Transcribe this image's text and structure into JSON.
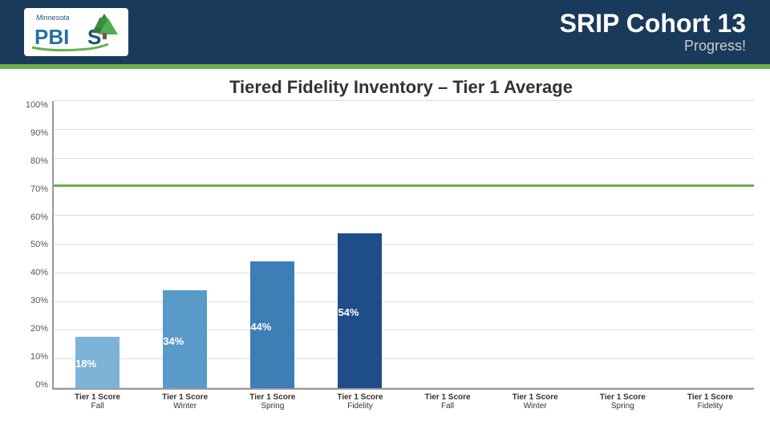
{
  "header": {
    "title": "SRIP Cohort 13",
    "subtitle": "Progress!"
  },
  "chart": {
    "title": "Tiered Fidelity Inventory – Tier 1 Average",
    "y_labels": [
      "100%",
      "90%",
      "80%",
      "70%",
      "60%",
      "50%",
      "40%",
      "30%",
      "20%",
      "10%",
      "0%"
    ],
    "target_pct": 70,
    "bars": [
      {
        "label_line1": "Tier 1 Score",
        "label_line2": "Fall",
        "value": 18,
        "color": "#7eb3d8",
        "show": true
      },
      {
        "label_line1": "Tier 1 Score",
        "label_line2": "Winter",
        "value": 34,
        "color": "#5a9ac9",
        "show": true
      },
      {
        "label_line1": "Tier 1 Score",
        "label_line2": "Spring",
        "value": 44,
        "color": "#3d7eb5",
        "show": true
      },
      {
        "label_line1": "Tier 1 Score",
        "label_line2": "Fidelity",
        "value": 54,
        "color": "#1e4d8a",
        "show": true
      },
      {
        "label_line1": "Tier 1 Score",
        "label_line2": "Fall",
        "value": null,
        "color": "#7eb3d8",
        "show": false
      },
      {
        "label_line1": "Tier 1 Score",
        "label_line2": "Winter",
        "value": null,
        "color": "#5a9ac9",
        "show": false
      },
      {
        "label_line1": "Tier 1 Score",
        "label_line2": "Spring",
        "value": null,
        "color": "#3d7eb5",
        "show": false
      },
      {
        "label_line1": "Tier 1 Score",
        "label_line2": "Fidelity",
        "value": null,
        "color": "#1e4d8a",
        "show": false
      }
    ]
  },
  "logo": {
    "text": "PBIS",
    "state": "Minnesota"
  }
}
